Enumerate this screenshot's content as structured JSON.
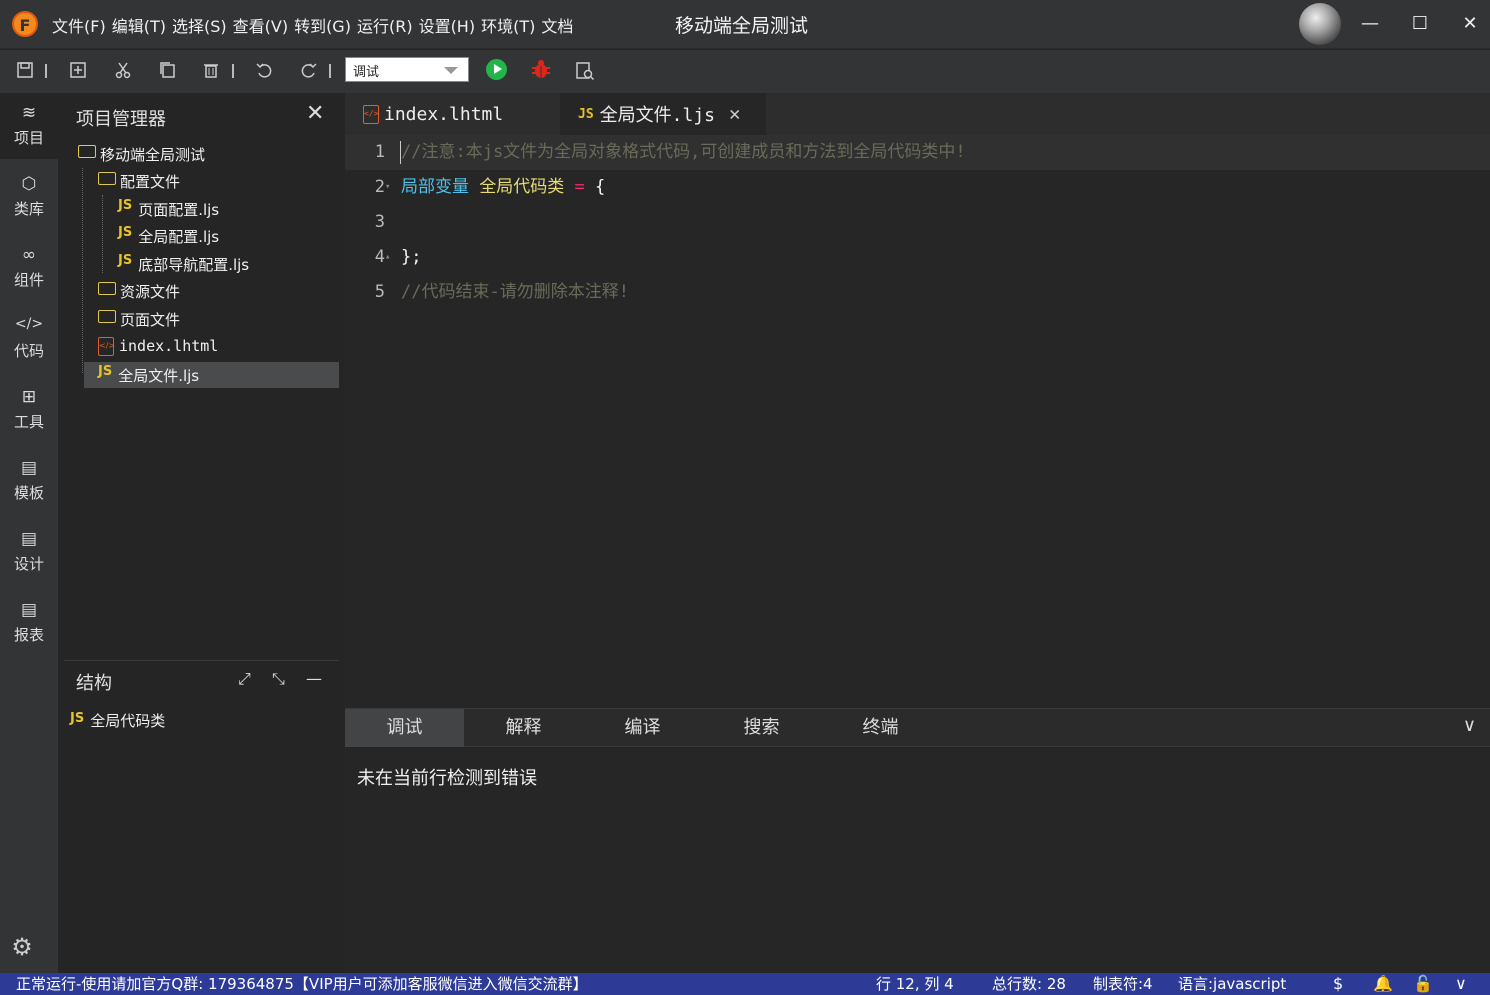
{
  "title_bar": {
    "logo_letter": "F",
    "menu": [
      "文件(F)",
      "编辑(T)",
      "选择(S)",
      "查看(V)",
      "转到(G)",
      "运行(R)",
      "设置(H)",
      "环境(T)",
      "文档"
    ],
    "project_title": "移动端全局测试",
    "minimize": "—",
    "maximize": "☐",
    "close": "✕"
  },
  "toolbar": {
    "mode_select_value": "调试",
    "icons": [
      "save-icon",
      "new-file-icon",
      "cut-icon",
      "copy-icon",
      "delete-icon",
      "undo-icon",
      "redo-icon",
      "run-icon",
      "debug-icon",
      "search-file-icon"
    ]
  },
  "activity_bar": {
    "items": [
      {
        "icon": "≋",
        "label": "项目"
      },
      {
        "icon": "⬡",
        "label": "类库"
      },
      {
        "icon": "∞",
        "label": "组件"
      },
      {
        "icon": "</>",
        "label": "代码"
      },
      {
        "icon": "⊞",
        "label": "工具"
      },
      {
        "icon": "▤",
        "label": "模板"
      },
      {
        "icon": "▤",
        "label": "设计"
      },
      {
        "icon": "▤",
        "label": "报表"
      }
    ],
    "settings_icon": "⚙"
  },
  "explorer": {
    "title": "项目管理器",
    "close": "✕",
    "tree": [
      {
        "label": "移动端全局测试",
        "type": "folder"
      },
      {
        "label": "配置文件",
        "type": "folder"
      },
      {
        "label": "页面配置.ljs",
        "type": "js"
      },
      {
        "label": "全局配置.ljs",
        "type": "js"
      },
      {
        "label": "底部导航配置.ljs",
        "type": "js"
      },
      {
        "label": "资源文件",
        "type": "folder"
      },
      {
        "label": "页面文件",
        "type": "folder"
      },
      {
        "label": "index.lhtml",
        "type": "html"
      },
      {
        "label": "全局文件.ljs",
        "type": "js"
      }
    ],
    "js_badge": "JS",
    "html_badge": "</>"
  },
  "structure": {
    "title": "结构",
    "expand": "⤢",
    "collapse": "⤡",
    "minimize": "—",
    "items": [
      "全局代码类"
    ]
  },
  "editor": {
    "tabs": [
      {
        "label": "index.lhtml"
      },
      {
        "label": "全局文件.ljs",
        "close": "✕"
      }
    ],
    "lines": [
      {
        "n": "1",
        "comment": "//注意:本js文件为全局对象格式代码,可创建成员和方法到全局代码类中!"
      },
      {
        "n": "2",
        "fold": "▾",
        "kw": "局部变量",
        "cls": "全局代码类",
        "op": "=",
        "punct": "{"
      },
      {
        "n": "3"
      },
      {
        "n": "4",
        "fold": "▴",
        "punct": "};"
      },
      {
        "n": "5",
        "comment": "//代码结束-请勿删除本注释!"
      }
    ]
  },
  "output_panel": {
    "tabs": [
      "调试",
      "解释",
      "编译",
      "搜索",
      "终端"
    ],
    "chevron": "∨",
    "message": "未在当前行检测到错误"
  },
  "status_bar": {
    "left_text": "正常运行-使用请加官方Q群: 179364875【VIP用户可添加客服微信进入微信交流群】",
    "position": "行 12, 列 4",
    "total_lines": "总行数: 28",
    "tab_size": "制表符:4",
    "language": "语言:javascript",
    "icons": [
      "$",
      "🔔",
      "🔓",
      "∨"
    ]
  }
}
